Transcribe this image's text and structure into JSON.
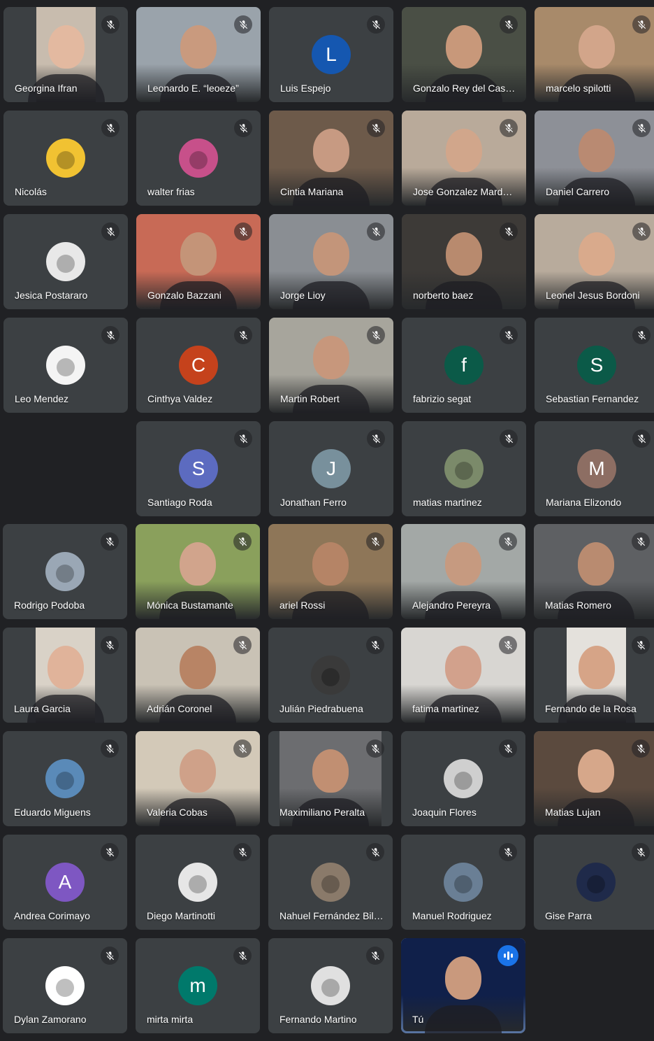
{
  "meeting": {
    "participants": [
      {
        "name": "Georgina Ifran",
        "type": "video",
        "bg": "#c8bcae",
        "cam_w": 0.48,
        "face": "#e3b9a0",
        "muted": true
      },
      {
        "name": "Leonardo E. “leoeze”",
        "type": "video",
        "bg": "#9aa3ab",
        "cam_w": 1,
        "face": "#c99a7e",
        "muted": true
      },
      {
        "name": "Luis Espejo",
        "type": "letter",
        "letter": "L",
        "color": "#1557b0",
        "muted": true
      },
      {
        "name": "Gonzalo Rey del Castillo",
        "type": "video",
        "bg": "#4a4f45",
        "cam_w": 1,
        "face": "#c8987a",
        "muted": true
      },
      {
        "name": "marcelo spilotti",
        "type": "video",
        "bg": "#a88a6a",
        "cam_w": 1,
        "face": "#d2a58a",
        "muted": true
      },
      {
        "name": "Nicolás",
        "type": "photo",
        "color": "#f1c232",
        "muted": true
      },
      {
        "name": "walter frias",
        "type": "photo",
        "color": "#c7508a",
        "muted": true
      },
      {
        "name": "Cintia Mariana",
        "type": "video",
        "bg": "#6d5a4a",
        "cam_w": 1,
        "face": "#c79a82",
        "muted": true
      },
      {
        "name": "Jose Gonzalez Mardones",
        "type": "video",
        "bg": "#b9aa9a",
        "cam_w": 1,
        "face": "#d1a68b",
        "muted": true
      },
      {
        "name": "Daniel Carrero",
        "type": "video",
        "bg": "#8d9097",
        "cam_w": 1,
        "face": "#b98a72",
        "muted": true
      },
      {
        "name": "Jesica Postararo",
        "type": "photo",
        "color": "#e8e8e8",
        "muted": true
      },
      {
        "name": "Gonzalo Bazzani",
        "type": "video",
        "bg": "#c86a56",
        "cam_w": 1,
        "face": "#c49478",
        "muted": true
      },
      {
        "name": "Jorge Lioy",
        "type": "video",
        "bg": "#8a8e93",
        "cam_w": 1,
        "face": "#c3957a",
        "muted": true
      },
      {
        "name": "norberto baez",
        "type": "video",
        "bg": "#3d3a37",
        "cam_w": 1,
        "face": "#b88a6e",
        "muted": true
      },
      {
        "name": "Leonel Jesus Bordoni",
        "type": "video",
        "bg": "#b8ab9c",
        "cam_w": 1,
        "face": "#d9aa8c",
        "muted": true
      },
      {
        "name": "Leo Mendez",
        "type": "photo",
        "color": "#f4f4f4",
        "muted": true
      },
      {
        "name": "Cinthya Valdez",
        "type": "letter",
        "letter": "C",
        "color": "#c5421c",
        "muted": true
      },
      {
        "name": "Martin Robert",
        "type": "video",
        "bg": "#a7a59c",
        "cam_w": 1,
        "face": "#c7977c",
        "muted": true
      },
      {
        "name": "fabrizio segat",
        "type": "letter",
        "letter": "f",
        "color": "#0b5a48",
        "muted": true
      },
      {
        "name": "Sebastian Fernandez",
        "type": "letter",
        "letter": "S",
        "color": "#0b5a48",
        "muted": true
      },
      {
        "name": "Santiago Roda",
        "type": "letter",
        "letter": "S",
        "color": "#5c6bc0",
        "muted": true
      },
      {
        "name": "Jonathan Ferro",
        "type": "letter",
        "letter": "J",
        "color": "#78909c",
        "muted": true
      },
      {
        "name": "matias martinez",
        "type": "photo",
        "color": "#7b8a6a",
        "muted": true
      },
      {
        "name": "Mariana Elizondo",
        "type": "letter",
        "letter": "M",
        "color": "#8d6e63",
        "muted": true
      },
      {
        "name": "Rodrigo Podoba",
        "type": "photo",
        "color": "#9aa7b5",
        "muted": true
      },
      {
        "name": "Mónica Bustamante",
        "type": "video",
        "bg": "#8aa05c",
        "cam_w": 1,
        "face": "#d1a48c",
        "muted": true
      },
      {
        "name": "ariel Rossi",
        "type": "video",
        "bg": "#8e7658",
        "cam_w": 1,
        "face": "#b58466",
        "muted": true
      },
      {
        "name": "Alejandro Pereyra",
        "type": "video",
        "bg": "#a3a8a6",
        "cam_w": 1,
        "face": "#c69a80",
        "muted": true
      },
      {
        "name": "Matias Romero",
        "type": "video",
        "bg": "#5e6063",
        "cam_w": 1,
        "face": "#b98b70",
        "muted": true
      },
      {
        "name": "Laura Garcia",
        "type": "video",
        "bg": "#d9d2c7",
        "cam_w": 0.48,
        "face": "#e0b39a",
        "muted": true
      },
      {
        "name": "Adrián Coronel",
        "type": "video",
        "bg": "#c9c2b5",
        "cam_w": 1,
        "face": "#b88465",
        "muted": true
      },
      {
        "name": "Julián Piedrabuena",
        "type": "photo",
        "color": "#3a3a3a",
        "muted": true
      },
      {
        "name": "fatima martinez",
        "type": "video",
        "bg": "#d8d6d2",
        "cam_w": 1,
        "face": "#d2a18c",
        "muted": true
      },
      {
        "name": "Fernando de la Rosa",
        "type": "video",
        "bg": "#e4e1dc",
        "cam_w": 0.48,
        "face": "#d6a487",
        "muted": true
      },
      {
        "name": "Eduardo Miguens",
        "type": "photo",
        "color": "#5a8ab8",
        "muted": true
      },
      {
        "name": "Valeria Cobas",
        "type": "video",
        "bg": "#d3c9b8",
        "cam_w": 1,
        "face": "#cfa189",
        "muted": true
      },
      {
        "name": "Maximiliano Peralta",
        "type": "video",
        "bg": "#6c6d70",
        "cam_w": 0.82,
        "face": "#c18f72",
        "muted": true
      },
      {
        "name": "Joaquin Flores",
        "type": "photo",
        "color": "#cfcfcf",
        "muted": true
      },
      {
        "name": "Matias Lujan",
        "type": "video",
        "bg": "#5b4a3e",
        "cam_w": 1,
        "face": "#d6a78a",
        "muted": true
      },
      {
        "name": "Andrea Corimayo",
        "type": "letter",
        "letter": "A",
        "color": "#7e57c2",
        "muted": true
      },
      {
        "name": "Diego Martinotti",
        "type": "photo",
        "color": "#e6e6e6",
        "muted": true
      },
      {
        "name": "Nahuel Fernández Bilbao",
        "type": "photo",
        "color": "#8a7a6a",
        "muted": true
      },
      {
        "name": "Manuel Rodriguez",
        "type": "photo",
        "color": "#6a7f95",
        "muted": true
      },
      {
        "name": "Gise Parra",
        "type": "photo",
        "color": "#1f2a4a",
        "muted": true
      },
      {
        "name": "Dylan Zamorano",
        "type": "photo",
        "color": "#ffffff",
        "muted": true
      },
      {
        "name": "mirta mirta",
        "type": "letter",
        "letter": "m",
        "color": "#00796b",
        "muted": true
      },
      {
        "name": "Fernando Martino",
        "type": "photo",
        "color": "#e0e0e0",
        "muted": true
      },
      {
        "name": "Tú",
        "type": "video",
        "bg": "#10204a",
        "cam_w": 1,
        "face": "#c9997d",
        "muted": false,
        "self": true,
        "speaking": true
      }
    ]
  }
}
